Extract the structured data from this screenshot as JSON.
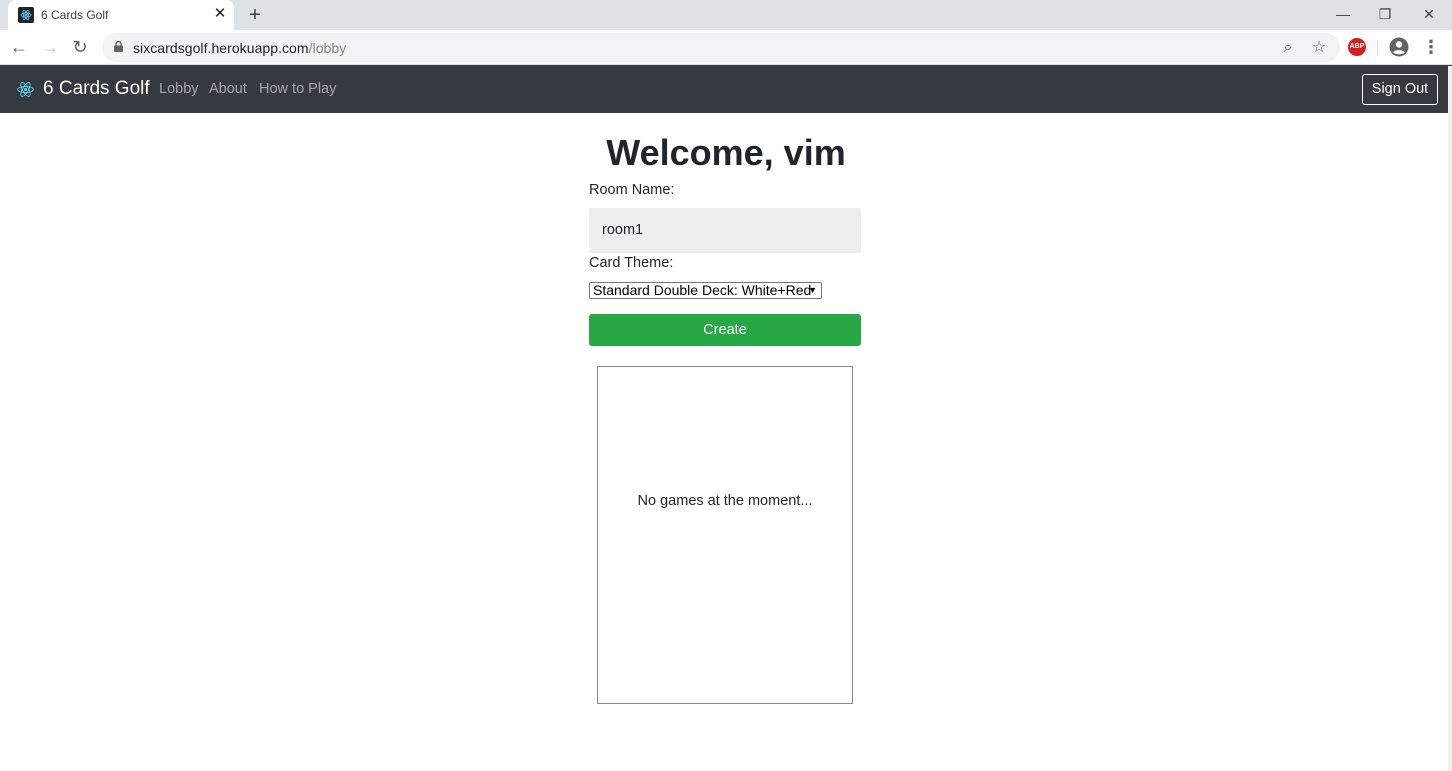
{
  "browser": {
    "tab_title": "6 Cards Golf",
    "tab_close": "✕",
    "new_tab": "+",
    "window": {
      "minimize": "—",
      "restore": "❐",
      "close": "✕"
    },
    "nav": {
      "back": "←",
      "forward": "→",
      "reload": "↻"
    },
    "url_host": "sixcardsgolf.herokuapp.com",
    "url_path": "/lobby",
    "zoom_icon": "⌕",
    "star_icon": "☆",
    "extension_label": "ABP",
    "menu": "⋮"
  },
  "navbar": {
    "brand": "6 Cards Golf",
    "links": [
      "Lobby",
      "About",
      "How to Play"
    ],
    "sign_out": "Sign Out"
  },
  "lobby": {
    "welcome": "Welcome, vim",
    "room_name_label": "Room Name:",
    "room_name_value": "room1",
    "card_theme_label": "Card Theme:",
    "card_theme_selected": "Standard Double Deck: White+Red",
    "create_label": "Create",
    "empty_games": "No games at the moment..."
  },
  "colors": {
    "navbar_bg": "#343a40",
    "create_button": "#28a745",
    "react_logo": "#61dafb"
  }
}
